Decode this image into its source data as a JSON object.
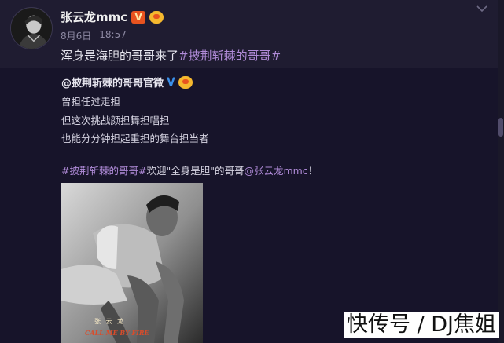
{
  "post": {
    "author": "张云龙mmc",
    "vip_badge": "V",
    "date": "8月6日",
    "time": "18:57",
    "text_prefix": "浑身是海胆的哥哥来了",
    "hashtag": "#披荆斩棘的哥哥#",
    "collapse_icon": "chevron-down-icon"
  },
  "repost": {
    "author": "@披荆斩棘的哥哥官微",
    "verified_icon": "blue-v",
    "lines": [
      "曾担任过走担",
      "但这次挑战颜担舞担唱担",
      "也能分分钟担起重担的舞台担当者"
    ],
    "tag_hashtag": "#披荆斩棘的哥哥#",
    "tag_middle": "欢迎\"全身是胆\"的哥哥",
    "tag_mention": "@张云龙mmc",
    "tag_end": "！",
    "photo": {
      "caption": "张 云 龙",
      "subcaption": "CALL ME BY FIRE"
    }
  },
  "watermark": "快传号 / DJ焦姐",
  "colors": {
    "background": "#1f1c31",
    "repost_background": "#17142a",
    "link": "#b08bd8",
    "verified": "#3b8fe8"
  }
}
